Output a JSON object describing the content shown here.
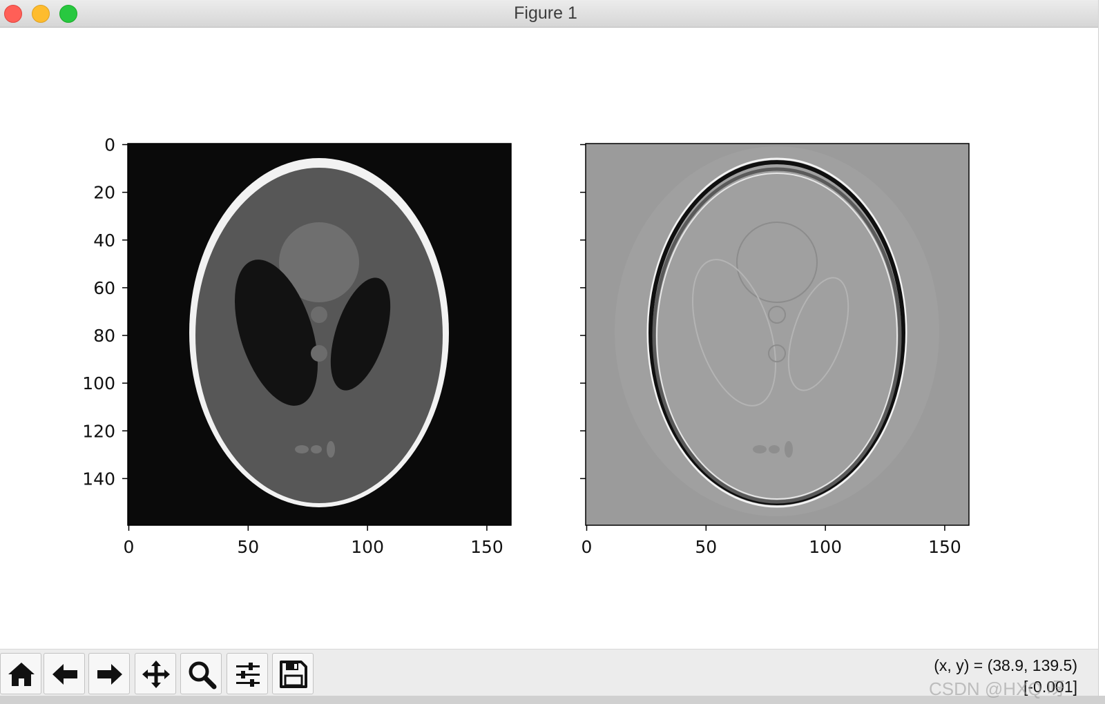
{
  "window": {
    "title": "Figure 1"
  },
  "figure": {
    "subplots": [
      {
        "name": "left",
        "colormap": "gray",
        "background_color": "#0a0a0a",
        "x_ticks": [
          "0",
          "50",
          "100",
          "150"
        ],
        "y_ticks": [
          "0",
          "20",
          "40",
          "60",
          "80",
          "100",
          "120",
          "140"
        ]
      },
      {
        "name": "right",
        "colormap": "gray",
        "background_color": "#9b9b9b",
        "x_ticks": [
          "0",
          "50",
          "100",
          "150"
        ],
        "y_ticks": []
      }
    ]
  },
  "toolbar": {
    "buttons": [
      {
        "name": "home-button",
        "icon": "home-icon"
      },
      {
        "name": "back-button",
        "icon": "arrow-left-icon"
      },
      {
        "name": "forward-button",
        "icon": "arrow-right-icon"
      },
      {
        "name": "pan-button",
        "icon": "move-icon"
      },
      {
        "name": "zoom-button",
        "icon": "magnifier-icon"
      },
      {
        "name": "configure-subplots-button",
        "icon": "sliders-icon"
      },
      {
        "name": "save-button",
        "icon": "floppy-icon"
      }
    ],
    "coordinates": "(x, y) = (38.9, 139.5)",
    "pixel_value": "[-0.001]"
  },
  "watermark": "CSDN @HXQ 呀"
}
